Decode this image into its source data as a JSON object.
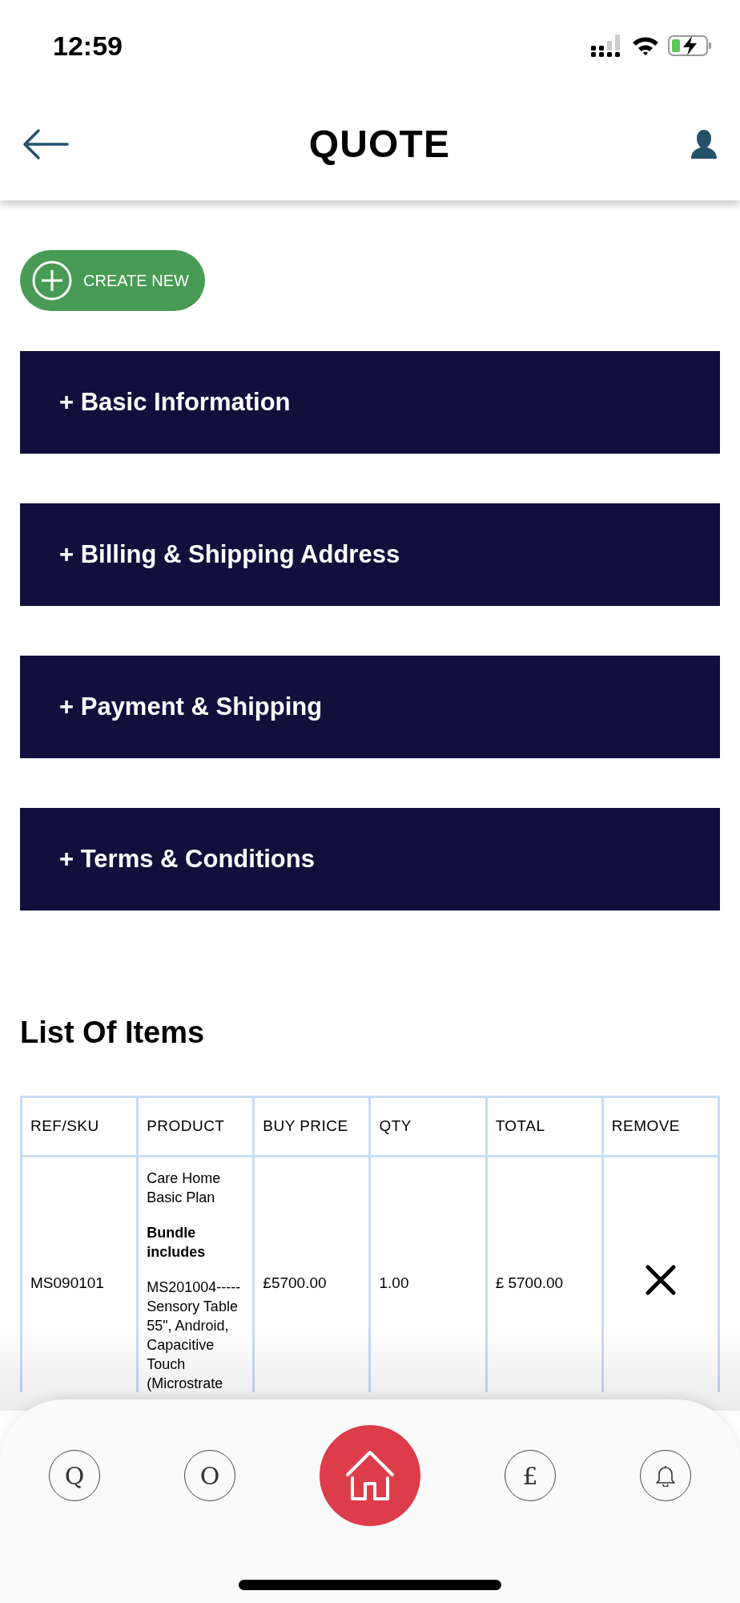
{
  "status_bar": {
    "time": "12:59"
  },
  "header": {
    "title": "QUOTE"
  },
  "create_button": {
    "label": "CREATE NEW"
  },
  "sections": [
    {
      "title": "+ Basic Information"
    },
    {
      "title": "+ Billing & Shipping Address"
    },
    {
      "title": "+ Payment & Shipping"
    },
    {
      "title": "+ Terms & Conditions"
    }
  ],
  "items": {
    "heading": "List Of Items",
    "columns": [
      "REF/SKU",
      "PRODUCT",
      "BUY PRICE",
      "QTY",
      "TOTAL",
      "REMOVE"
    ],
    "rows": [
      {
        "sku": "MS090101",
        "product": [
          {
            "text": "Care Home Basic Plan",
            "bold": false
          },
          {
            "text": "Bundle includes",
            "bold": true
          },
          {
            "text": "MS201004-----Sensory Table 55\", Android, Capacitive Touch (Microstrate",
            "bold": false
          }
        ],
        "price": "£5700.00",
        "qty": "1.00",
        "total": "£ 5700.00"
      }
    ]
  },
  "tab_bar": [
    {
      "kind": "letter",
      "text": "Q",
      "selected": false
    },
    {
      "kind": "letter",
      "text": "O",
      "selected": false
    },
    {
      "kind": "home",
      "selected": true
    },
    {
      "kind": "letter",
      "text": "£",
      "selected": false
    },
    {
      "kind": "bell",
      "selected": false
    }
  ]
}
